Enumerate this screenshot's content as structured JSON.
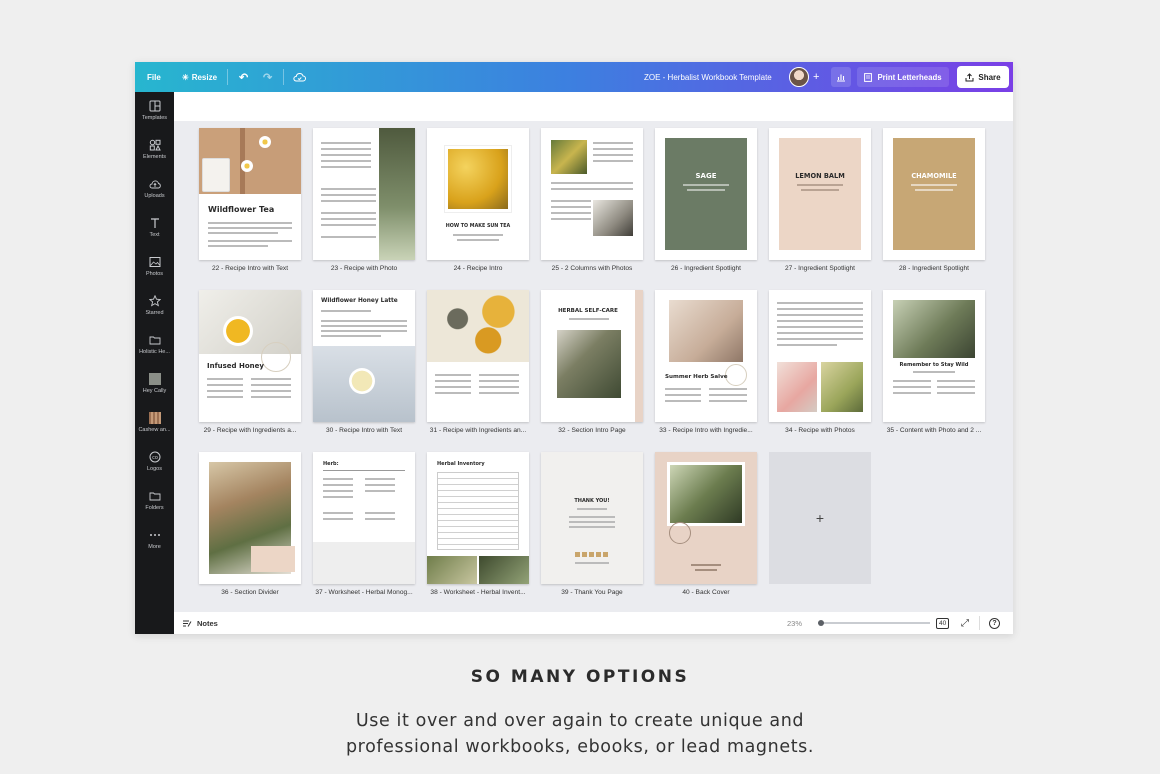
{
  "topbar": {
    "file_label": "File",
    "resize_label": "Resize",
    "doc_title": "ZOE - Herbalist Workbook Template",
    "print_label": "Print Letterheads",
    "share_label": "Share"
  },
  "sidebar": {
    "items": [
      {
        "label": "Templates",
        "icon": "templates-icon"
      },
      {
        "label": "Elements",
        "icon": "elements-icon"
      },
      {
        "label": "Uploads",
        "icon": "uploads-icon"
      },
      {
        "label": "Text",
        "icon": "text-icon"
      },
      {
        "label": "Photos",
        "icon": "photos-icon"
      },
      {
        "label": "Starred",
        "icon": "star-icon"
      },
      {
        "label": "Holistic He...",
        "icon": "folder-icon"
      },
      {
        "label": "Hey Cally",
        "icon": "thumbnail-icon"
      },
      {
        "label": "Cashew an...",
        "icon": "thumbnail-icon"
      },
      {
        "label": "Logos",
        "icon": "logos-icon"
      },
      {
        "label": "Folders",
        "icon": "folder-icon"
      },
      {
        "label": "More",
        "icon": "more-icon"
      }
    ]
  },
  "pages": {
    "row1": [
      {
        "caption": "22 - Recipe Intro with Text",
        "title": "Wildflower Tea"
      },
      {
        "caption": "23 - Recipe with Photo",
        "title": ""
      },
      {
        "caption": "24 - Recipe Intro",
        "title": "HOW TO MAKE SUN TEA"
      },
      {
        "caption": "25 - 2 Columns with Photos",
        "title": ""
      },
      {
        "caption": "26 - Ingredient Spotlight",
        "title": "SAGE"
      },
      {
        "caption": "27 - Ingredient Spotlight",
        "title": "LEMON BALM"
      },
      {
        "caption": "28 - Ingredient Spotlight",
        "title": "CHAMOMILE"
      }
    ],
    "row2": [
      {
        "caption": "29 - Recipe with Ingredients a...",
        "title": "Infused Honey"
      },
      {
        "caption": "30 - Recipe Intro with Text",
        "title": "Wildflower Honey Latte"
      },
      {
        "caption": "31 - Recipe with Ingredients an...",
        "title": ""
      },
      {
        "caption": "32 - Section Intro Page",
        "title": "HERBAL SELF-CARE"
      },
      {
        "caption": "33 - Recipe Intro with Ingredie...",
        "title": "Summer Herb Salve"
      },
      {
        "caption": "34 - Recipe with Photos",
        "title": ""
      },
      {
        "caption": "35 - Content with Photo and 2 ...",
        "title": "Remember to Stay Wild"
      }
    ],
    "row3": [
      {
        "caption": "36 - Section Divider",
        "title": ""
      },
      {
        "caption": "37 - Worksheet - Herbal Monog...",
        "title": "Herb:"
      },
      {
        "caption": "38 - Worksheet - Herbal Invent...",
        "title": "Herbal Inventory"
      },
      {
        "caption": "39 - Thank You Page",
        "title": "THANK YOU!"
      },
      {
        "caption": "40 - Back Cover",
        "title": ""
      }
    ],
    "add_label": "+"
  },
  "bottombar": {
    "notes_label": "Notes",
    "zoom": "23%",
    "page_count": "40",
    "help": "?"
  },
  "marketing": {
    "heading": "SO MANY OPTIONS",
    "line1": "Use it over and over again to create unique and",
    "line2": "professional workbooks, ebooks, or lead magnets."
  },
  "colors": {
    "sage": "#6b7b65",
    "lemon_balm": "#ecd6c6",
    "chamomile": "#c7a775",
    "back_cover": "#e8d3c6"
  }
}
